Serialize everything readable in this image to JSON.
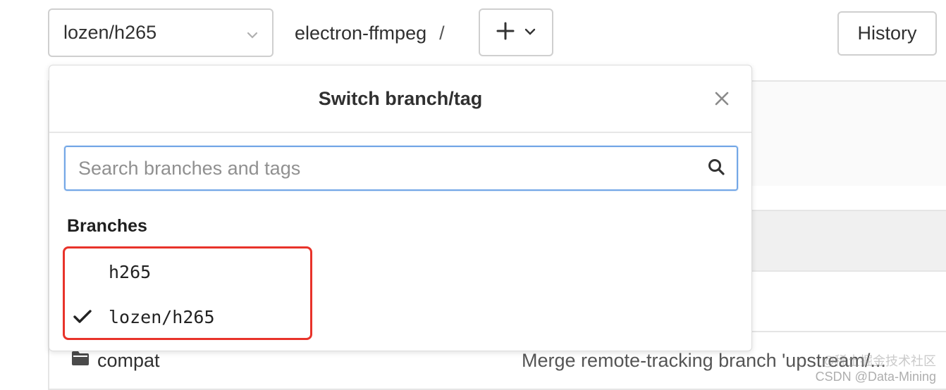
{
  "toolbar": {
    "branch_select_label": "lozen/h265",
    "repo_name": "electron-ffmpeg",
    "path_separator": "/",
    "history_label": "History"
  },
  "dropdown": {
    "title": "Switch branch/tag",
    "search_placeholder": "Search branches and tags",
    "search_value": "",
    "section_branches": "Branches",
    "branches": [
      {
        "name": "h265",
        "selected": false
      },
      {
        "name": "lozen/h265",
        "selected": true
      }
    ]
  },
  "file_list": {
    "rows": [
      {
        "name": "compat",
        "type": "folder",
        "commit": "Merge remote-tracking branch 'upstream/..."
      }
    ]
  },
  "watermark": {
    "line1": "@稀土掘金技术社区",
    "line2": "CSDN @Data-Mining"
  },
  "colors": {
    "focus_border": "#73a7e6",
    "annotation_red": "#e8332a",
    "border": "#cfcfcf"
  },
  "icons": {
    "branch_select_chevron": "chevron-down-icon",
    "add": "plus-icon",
    "close": "close-icon",
    "search": "search-icon",
    "check": "check-icon",
    "folder": "folder-icon"
  }
}
